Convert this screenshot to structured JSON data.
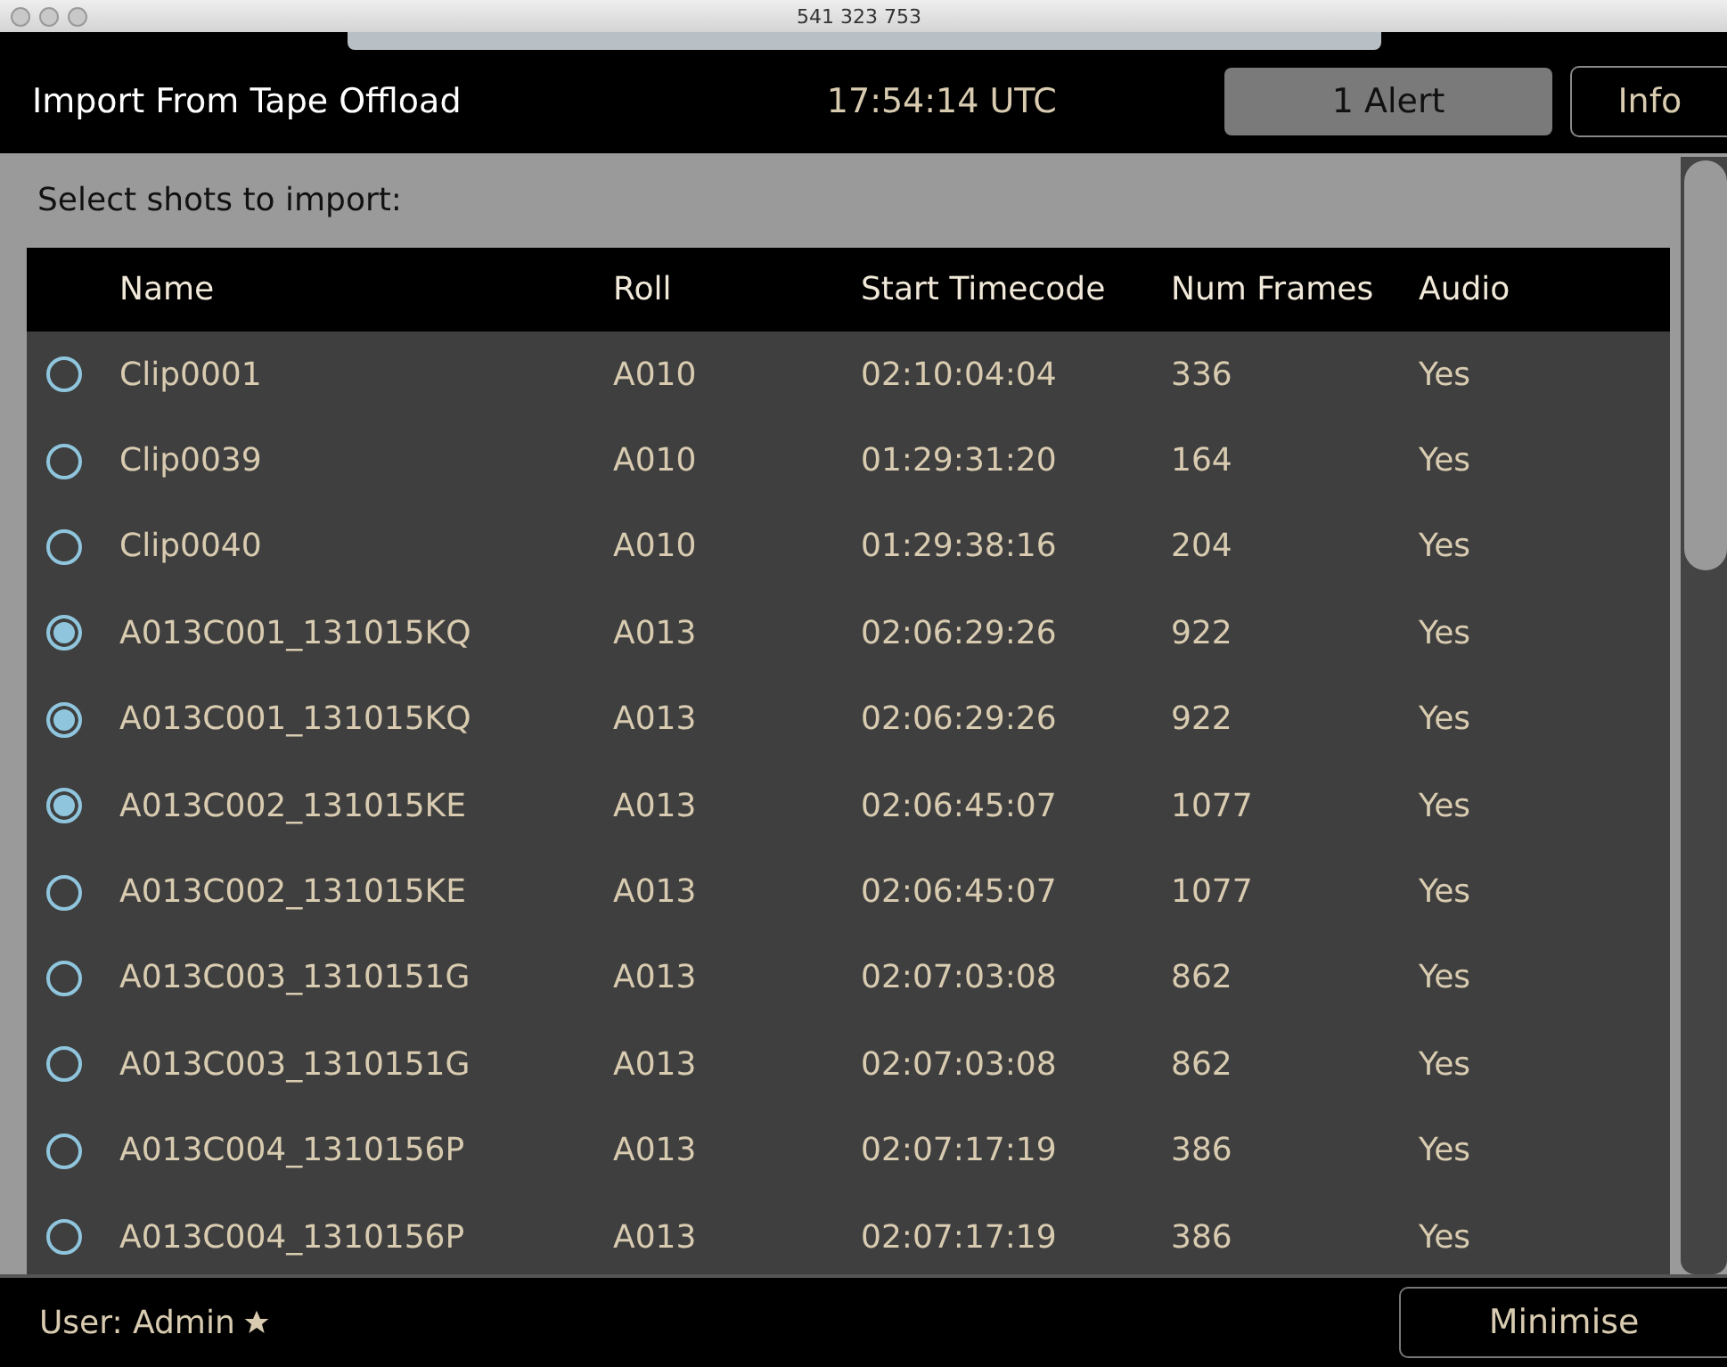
{
  "window": {
    "title": "541 323 753"
  },
  "header": {
    "title": "Import From Tape Offload",
    "clock": "17:54:14 UTC",
    "alert_button": "1 Alert",
    "info_button": "Info"
  },
  "prompt": "Select shots to import:",
  "table": {
    "columns": [
      "Name",
      "Roll",
      "Start Timecode",
      "Num Frames",
      "Audio"
    ],
    "rows": [
      {
        "selected": false,
        "cells": [
          "Clip0001",
          "A010",
          "02:10:04:04",
          "336",
          "Yes"
        ]
      },
      {
        "selected": false,
        "cells": [
          "Clip0039",
          "A010",
          "01:29:31:20",
          "164",
          "Yes"
        ]
      },
      {
        "selected": false,
        "cells": [
          "Clip0040",
          "A010",
          "01:29:38:16",
          "204",
          "Yes"
        ]
      },
      {
        "selected": true,
        "cells": [
          "A013C001_131015KQ",
          "A013",
          "02:06:29:26",
          "922",
          "Yes"
        ]
      },
      {
        "selected": true,
        "cells": [
          "A013C001_131015KQ",
          "A013",
          "02:06:29:26",
          "922",
          "Yes"
        ]
      },
      {
        "selected": true,
        "cells": [
          "A013C002_131015KE",
          "A013",
          "02:06:45:07",
          "1077",
          "Yes"
        ]
      },
      {
        "selected": false,
        "cells": [
          "A013C002_131015KE",
          "A013",
          "02:06:45:07",
          "1077",
          "Yes"
        ]
      },
      {
        "selected": false,
        "cells": [
          "A013C003_1310151G",
          "A013",
          "02:07:03:08",
          "862",
          "Yes"
        ]
      },
      {
        "selected": false,
        "cells": [
          "A013C003_1310151G",
          "A013",
          "02:07:03:08",
          "862",
          "Yes"
        ]
      },
      {
        "selected": false,
        "cells": [
          "A013C004_1310156P",
          "A013",
          "02:07:17:19",
          "386",
          "Yes"
        ]
      },
      {
        "selected": false,
        "cells": [
          "A013C004_1310156P",
          "A013",
          "02:07:17:19",
          "386",
          "Yes"
        ]
      }
    ]
  },
  "footer": {
    "user": "User: Admin",
    "minimise_button": "Minimise"
  }
}
